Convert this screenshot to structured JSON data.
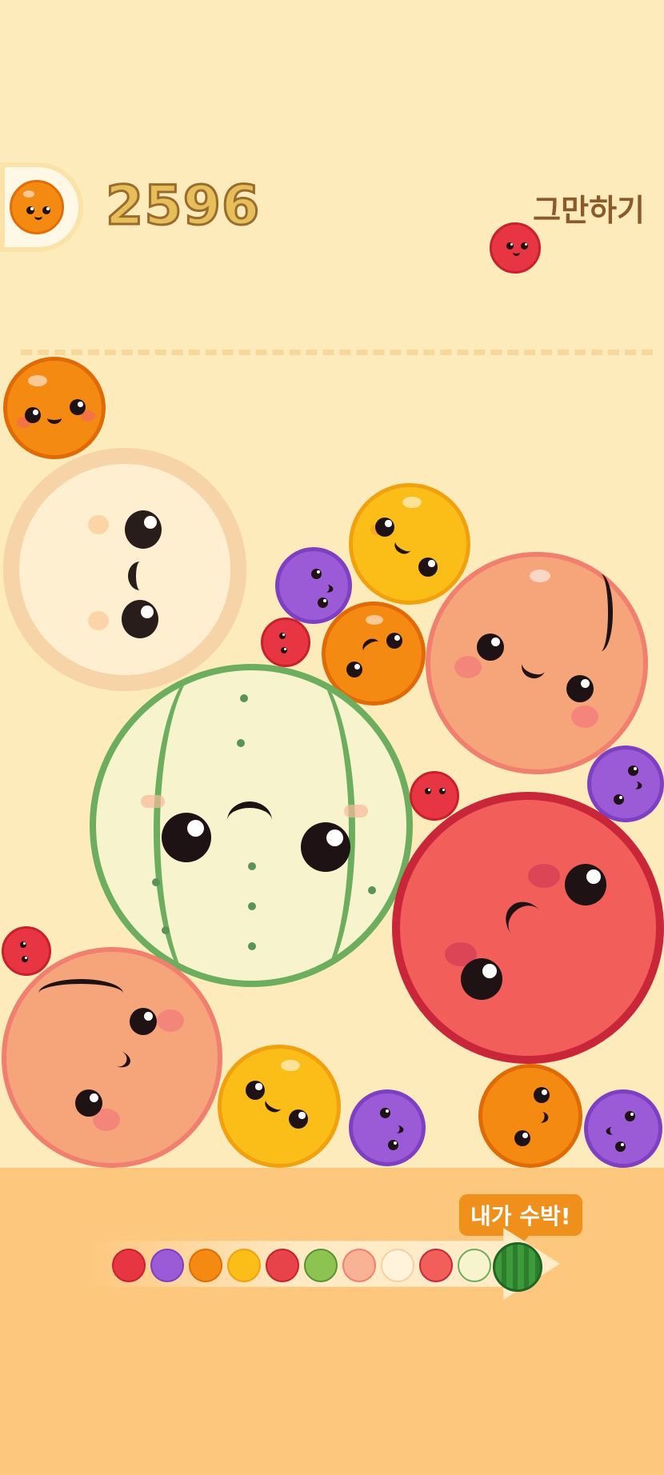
{
  "hud": {
    "score": "2596",
    "quit_label": "그만하기"
  },
  "evolution": {
    "tooltip": "내가 수박!",
    "icons": [
      "cherry-icon",
      "grape-icon",
      "orange-icon",
      "lemon-icon",
      "strawberry-icon",
      "kiwi-icon",
      "peach-icon",
      "melon-pale-icon",
      "apple-icon",
      "melon-icon",
      "watermelon-icon"
    ]
  },
  "colors": {
    "background": "#fdebbb",
    "panel": "#fdc77e",
    "score_fill": "#e6be5a",
    "score_outline": "#9b6b2e",
    "tooltip": "#f0901c",
    "cherry": "#e83543",
    "grape": "#9b5ad6",
    "orange": "#f58a12",
    "lemon": "#fbbd17",
    "peach": "#f6a47a",
    "apple": "#f25e5a",
    "melon": "#f7f3cc",
    "melon_stripe": "#6cae5e"
  }
}
